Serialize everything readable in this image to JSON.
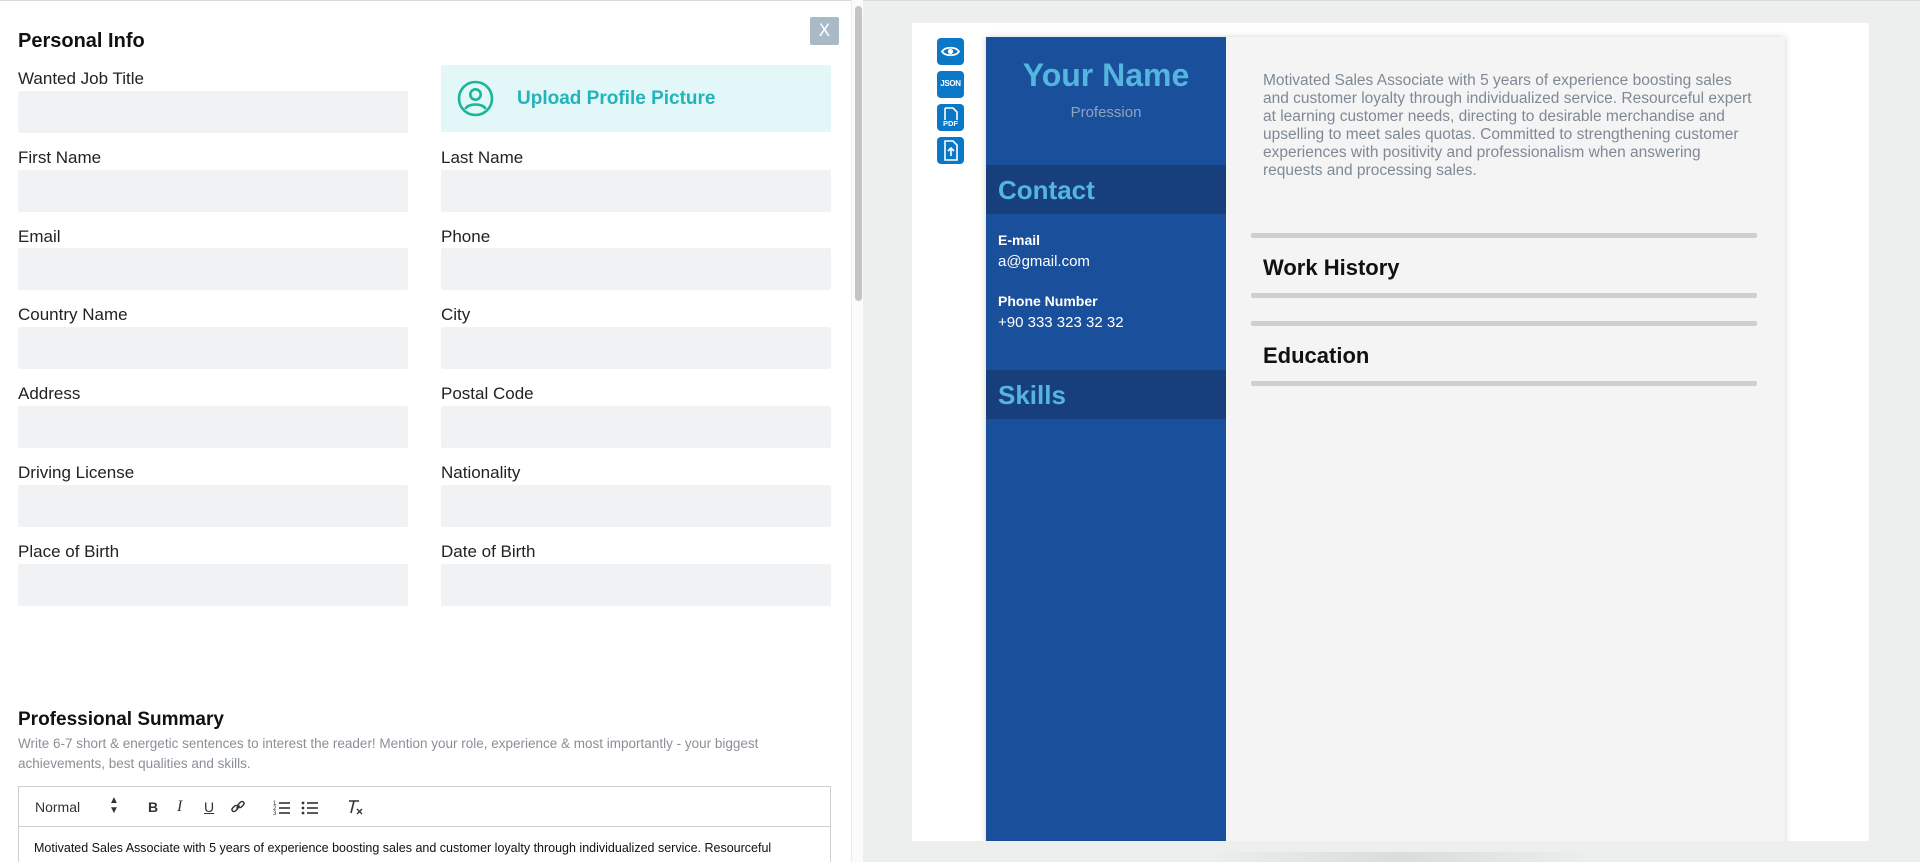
{
  "form": {
    "close_label": "X",
    "personal_info_title": "Personal Info",
    "upload_label": "Upload Profile Picture",
    "fields": {
      "wanted_job_title": "Wanted Job Title",
      "first_name": "First Name",
      "last_name": "Last Name",
      "email": "Email",
      "phone": "Phone",
      "country_name": "Country Name",
      "city": "City",
      "address": "Address",
      "postal_code": "Postal Code",
      "driving_license": "Driving License",
      "nationality": "Nationality",
      "place_of_birth": "Place of Birth",
      "date_of_birth": "Date of Birth"
    },
    "summary_title": "Professional Summary",
    "summary_hint": "Write 6-7 short & energetic sentences to interest the reader! Mention your role, experience & most importantly - your biggest achievements, best qualities and skills.",
    "editor": {
      "format_select": "Normal",
      "bold": "B",
      "italic": "I",
      "underline": "U",
      "body": "Motivated Sales Associate with 5 years of experience boosting sales and customer loyalty through individualized service. Resourceful"
    }
  },
  "toolbar": {
    "json_label": "JSON",
    "pdf_label": "PDF"
  },
  "resume": {
    "name": "Your Name",
    "profession": "Profession",
    "contact_title": "Contact",
    "email_label": "E-mail",
    "email_value": "a@gmail.com",
    "phone_label": "Phone Number",
    "phone_value": "+90 333 323 32 32",
    "skills_title": "Skills",
    "summary": "Motivated Sales Associate with 5 years of experience boosting sales and customer loyalty through individualized service. Resourceful expert at learning customer needs, directing to desirable merchandise and upselling to meet sales quotas. Committed to strengthening customer experiences with positivity and professionalism when answering requests and processing sales.",
    "work_history_title": "Work History",
    "education_title": "Education"
  },
  "colors": {
    "accent": "#0a78c7",
    "resume_sidebar": "#1a4f9c",
    "resume_band": "#173f7c",
    "resume_heading": "#54b6df",
    "upload_bg": "#e1f7f8",
    "upload_text": "#22b3bb"
  }
}
